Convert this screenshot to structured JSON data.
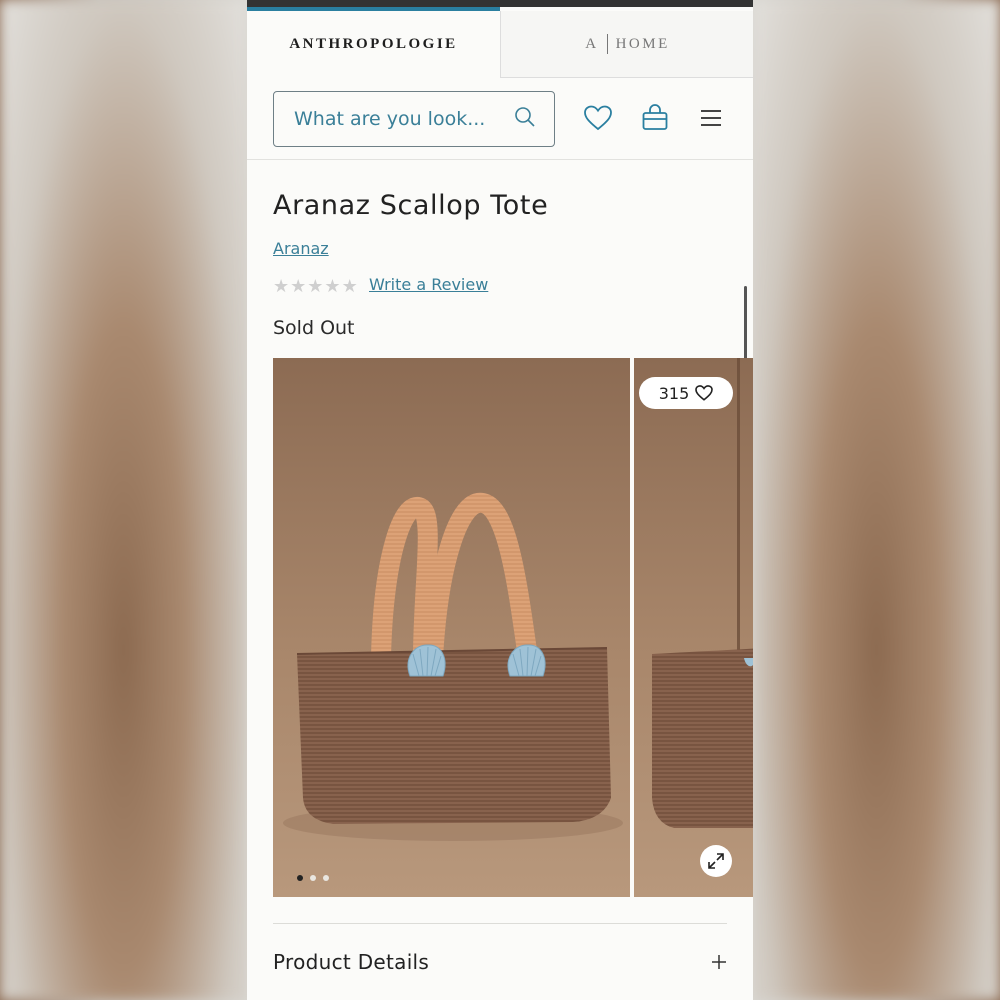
{
  "tabs": {
    "anthropologie": "ANTHROPOLOGIE",
    "home_a": "A",
    "home_label": "HOME"
  },
  "search": {
    "placeholder": "What are you look..."
  },
  "header_icons": [
    "search-icon",
    "heart-icon",
    "bag-icon",
    "menu-icon"
  ],
  "product": {
    "title": "Aranaz Scallop Tote",
    "brand": "Aranaz",
    "rating_stars": 0,
    "review_link": "Write a Review",
    "status": "Sold Out",
    "likes": "315",
    "gallery_dots": 3,
    "gallery_active_index": 0
  },
  "sections": {
    "product_details": "Product Details"
  },
  "colors": {
    "accent": "#2a7fa0",
    "text": "#222222"
  }
}
